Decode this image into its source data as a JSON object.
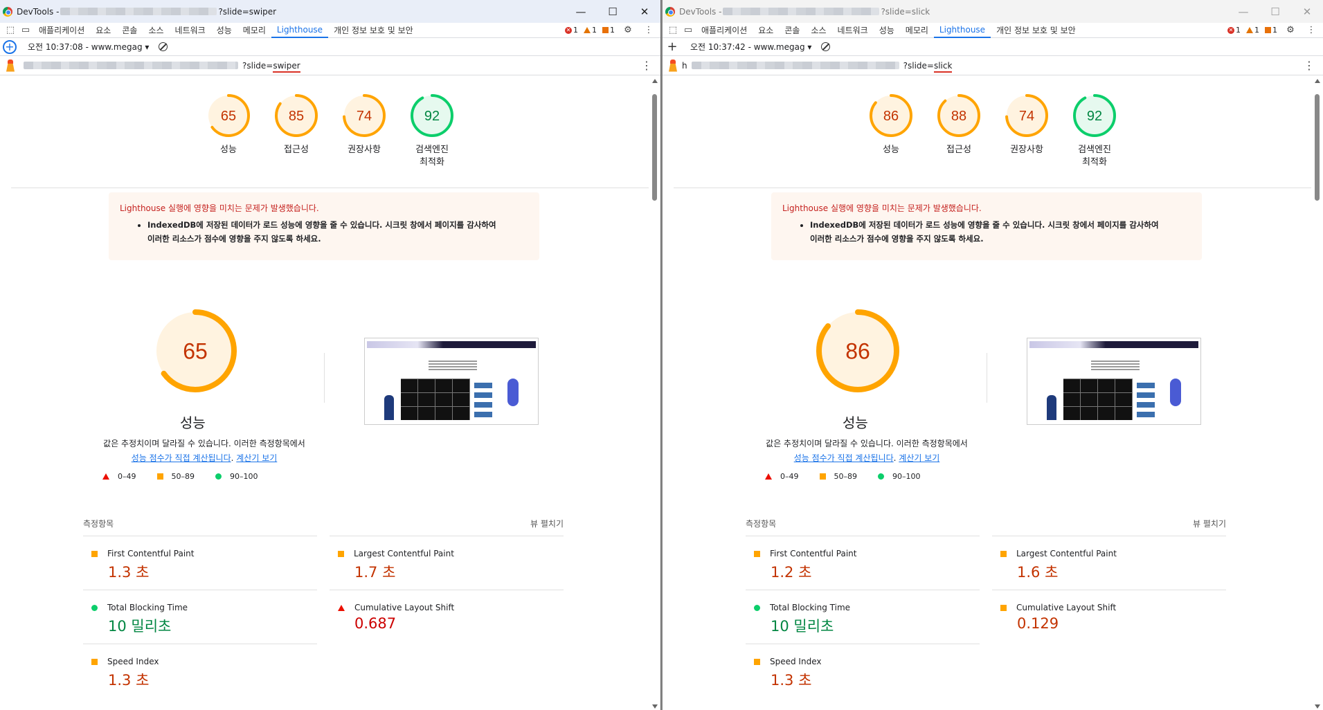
{
  "colors": {
    "fail": "#ff4e42",
    "average": "#ffa400",
    "pass": "#0cce6b",
    "accent": "#1a73e8"
  },
  "windows": [
    {
      "title_prefix": "DevTools - ",
      "title_suffix": "?slide=swiper",
      "url_prefix": "",
      "url_suffix": "?slide=",
      "url_param": "swiper",
      "report_time": "오전 10:37:08 - www.megag",
      "gauges": [
        {
          "score": 65,
          "label": "성능",
          "level": "average"
        },
        {
          "score": 85,
          "label": "접근성",
          "level": "average"
        },
        {
          "score": 74,
          "label": "권장사항",
          "level": "average"
        },
        {
          "score": 92,
          "label": "검색엔진\n최적화",
          "level": "pass"
        }
      ],
      "perf_score": 65,
      "metrics": [
        {
          "name": "First Contentful Paint",
          "value": "1.3 초",
          "level": "average"
        },
        {
          "name": "Largest Contentful Paint",
          "value": "1.7 초",
          "level": "average"
        },
        {
          "name": "Total Blocking Time",
          "value": "10 밀리초",
          "level": "pass"
        },
        {
          "name": "Cumulative Layout Shift",
          "value": "0.687",
          "level": "fail"
        },
        {
          "name": "Speed Index",
          "value": "1.3 초",
          "level": "average"
        }
      ]
    },
    {
      "title_prefix": "DevTools - ",
      "title_suffix": "?slide=slick",
      "url_prefix": "h",
      "url_suffix": "?slide=",
      "url_param": "slick",
      "report_time": "오전 10:37:42 - www.megag",
      "gauges": [
        {
          "score": 86,
          "label": "성능",
          "level": "average"
        },
        {
          "score": 88,
          "label": "접근성",
          "level": "average"
        },
        {
          "score": 74,
          "label": "권장사항",
          "level": "average"
        },
        {
          "score": 92,
          "label": "검색엔진\n최적화",
          "level": "pass"
        }
      ],
      "perf_score": 86,
      "metrics": [
        {
          "name": "First Contentful Paint",
          "value": "1.2 초",
          "level": "average"
        },
        {
          "name": "Largest Contentful Paint",
          "value": "1.6 초",
          "level": "average"
        },
        {
          "name": "Total Blocking Time",
          "value": "10 밀리초",
          "level": "pass"
        },
        {
          "name": "Cumulative Layout Shift",
          "value": "0.129",
          "level": "average"
        },
        {
          "name": "Speed Index",
          "value": "1.3 초",
          "level": "average"
        }
      ]
    }
  ],
  "tabs": [
    "애플리케이션",
    "요소",
    "콘솔",
    "소스",
    "네트워크",
    "성능",
    "메모리",
    "Lighthouse",
    "개인 정보 보호 및 보안"
  ],
  "active_tab": "Lighthouse",
  "issues": {
    "errors": "1",
    "warnings": "1",
    "info": "1"
  },
  "warning": {
    "title": "Lighthouse 실행에 영향을 미치는 문제가 발생했습니다.",
    "item_line1": "IndexedDB에 저장된 데이터가 로드 성능에 영향을 줄 수 있습니다. 시크릿 창에서 페이지를 감사하여",
    "item_line2": "이러한 리소스가 점수에 영향을 주지 않도록 하세요."
  },
  "perf_title": "성능",
  "desc_line1": "값은 추정치이며 달라질 수 있습니다. 이러한 측정항목에서",
  "desc_link1": "성능 점수가 직접 계산됩니다",
  "desc_link2": "계산기 보기",
  "legend": [
    "0–49",
    "50–89",
    "90–100"
  ],
  "metrics_title": "측정항목",
  "expand_view": "뷰 펼치기",
  "window_controls": {
    "minimize": "—",
    "maximize": "☐",
    "close": "✕"
  }
}
